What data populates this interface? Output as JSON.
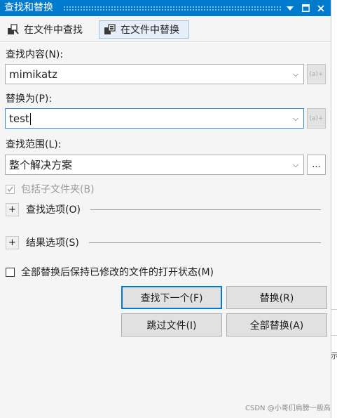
{
  "window": {
    "title": "查找和替换"
  },
  "tabs": [
    {
      "label": "在文件中查找",
      "icon": "find-in-files-icon"
    },
    {
      "label": "在文件中替换",
      "icon": "replace-in-files-icon",
      "active": true
    }
  ],
  "find": {
    "label": "查找内容(N):",
    "value": "mimikatz"
  },
  "replace": {
    "label": "替换为(P):",
    "value": "test"
  },
  "scope": {
    "label": "查找范围(L):",
    "value": "整个解决方案",
    "browse_label": "..."
  },
  "include_subfolders": {
    "label": "包括子文件夹(B)",
    "checked": true,
    "disabled": true
  },
  "sections": {
    "find_options": "查找选项(O)",
    "result_options": "结果选项(S)"
  },
  "keep_open": {
    "label": "全部替换后保持已修改的文件的打开状态(M)",
    "checked": false
  },
  "buttons": {
    "find_next": "查找下一个(F)",
    "replace": "替换(R)",
    "skip_file": "跳过文件(I)",
    "replace_all": "全部替换(A)"
  },
  "watermark": "CSDN @小哥们肩膀一般高",
  "colors": {
    "titlebar": "#007acc",
    "default_button_border": "#0078d7"
  }
}
